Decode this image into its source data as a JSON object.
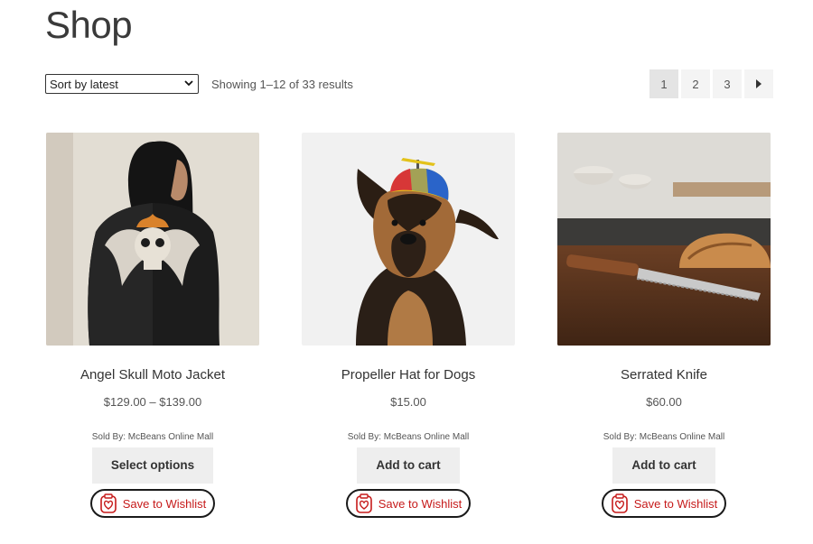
{
  "page": {
    "title": "Shop"
  },
  "toolbar": {
    "sort_selected": "Sort by latest",
    "sort_options": [
      "Sort by latest"
    ],
    "result_count": "Showing 1–12 of 33 results"
  },
  "pagination": {
    "pages": [
      "1",
      "2",
      "3"
    ],
    "current": "1",
    "next_icon": "triangle-right"
  },
  "products": [
    {
      "title": "Angel Skull Moto Jacket",
      "price": "$129.00 – $139.00",
      "sold_by": "Sold By: McBeans Online Mall",
      "button_label": "Select options",
      "wishlist_label": "Save to Wishlist",
      "image": "woman-in-black-leather-jacket-with-winged-skull"
    },
    {
      "title": "Propeller Hat for Dogs",
      "price": "$15.00",
      "sold_by": "Sold By: McBeans Online Mall",
      "button_label": "Add to cart",
      "wishlist_label": "Save to Wishlist",
      "image": "german-shepherd-wearing-propeller-hat"
    },
    {
      "title": "Serrated Knife",
      "price": "$60.00",
      "sold_by": "Sold By: McBeans Online Mall",
      "button_label": "Add to cart",
      "wishlist_label": "Save to Wishlist",
      "image": "serrated-knife-and-bread-on-wooden-counter"
    }
  ],
  "colors": {
    "wishlist_text": "#c61a1a",
    "button_bg": "#eeeeee",
    "page_btn_bg": "#f4f4f4"
  }
}
